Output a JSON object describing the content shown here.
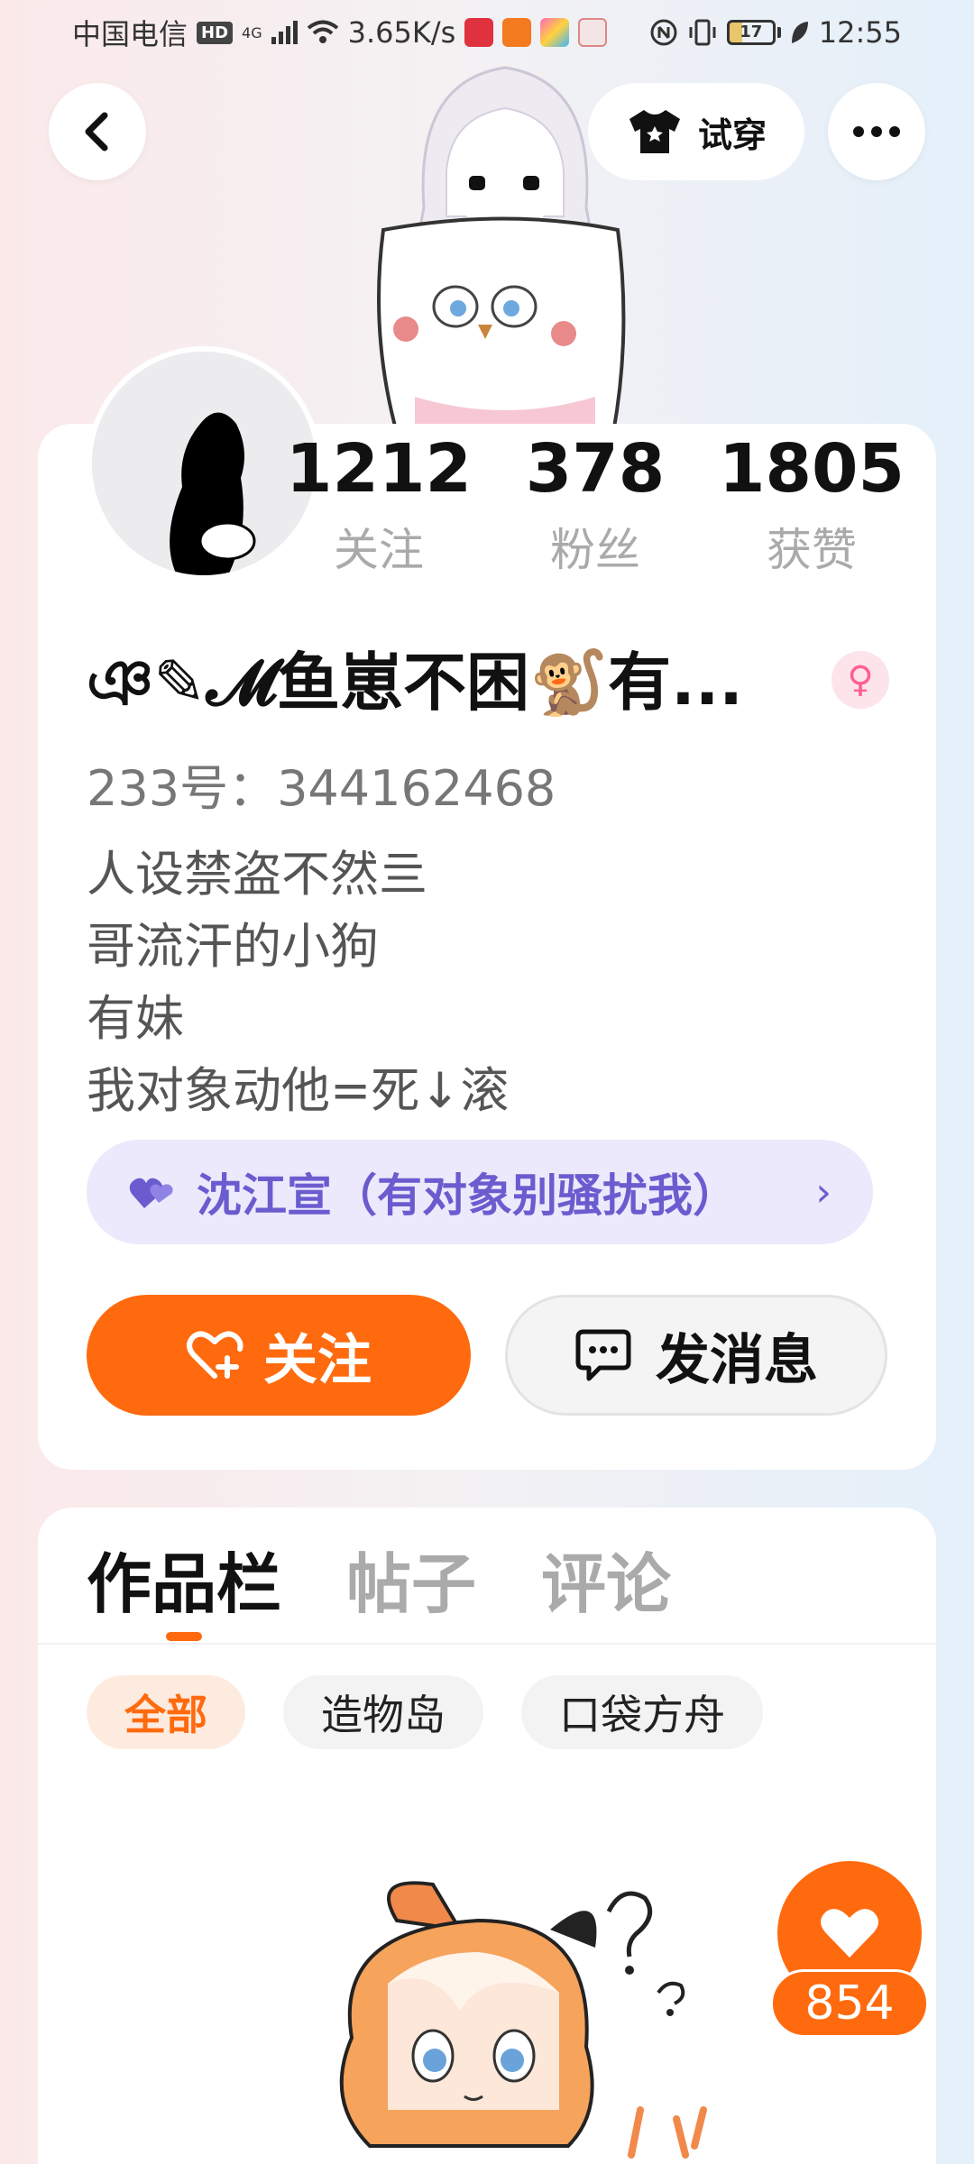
{
  "status_bar": {
    "carrier": "中国电信",
    "hd": "HD",
    "network": "4G",
    "speed": "3.65K/s",
    "battery": "17",
    "time": "12:55"
  },
  "header": {
    "tryon_label": "试穿"
  },
  "stats": [
    {
      "value": "1212",
      "label": "关注"
    },
    {
      "value": "378",
      "label": "粉丝"
    },
    {
      "value": "1805",
      "label": "获赞"
    }
  ],
  "profile": {
    "nickname": "ঞ✎𝓜鱼崽不困🐒有...",
    "gender_symbol": "♀",
    "user_id": "233号：344162468",
    "bio_lines": [
      "人设禁盗不然亖",
      "哥流汗的小狗",
      "有妹",
      "我对象动他=死↓滚"
    ],
    "relation_text": "沈江宣（有对象别骚扰我）"
  },
  "actions": {
    "follow_label": "关注",
    "message_label": "发消息"
  },
  "tabs": [
    "作品栏",
    "帖子",
    "评论"
  ],
  "filters": [
    "全部",
    "造物岛",
    "口袋方舟"
  ],
  "like_count": "854",
  "colors": {
    "accent": "#ff6a0e",
    "relation": "#6a5ccf",
    "relation_bg": "#ebe9fb"
  }
}
